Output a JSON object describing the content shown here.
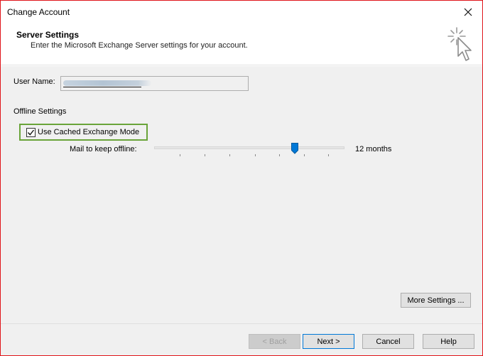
{
  "window": {
    "title": "Change Account"
  },
  "header": {
    "title": "Server Settings",
    "subtitle": "Enter the Microsoft Exchange Server settings for your account."
  },
  "form": {
    "username_label": "User Name:",
    "username_value": "",
    "offline_section_label": "Offline Settings",
    "cached_mode_label": "Use Cached Exchange Mode",
    "cached_mode_checked": true,
    "mail_keep_label": "Mail to keep offline:",
    "mail_keep_value": "12 months",
    "slider_position": 0.74,
    "more_settings_label": "More Settings ..."
  },
  "footer": {
    "back_label": "< Back",
    "next_label": "Next >",
    "cancel_label": "Cancel",
    "help_label": "Help"
  },
  "colors": {
    "window_border": "#e0151a",
    "highlight_border": "#6aa43a",
    "accent": "#0078d7"
  },
  "icons": {
    "close": "close-icon",
    "cursor": "cursor-click-icon",
    "check": "checkmark-icon"
  }
}
